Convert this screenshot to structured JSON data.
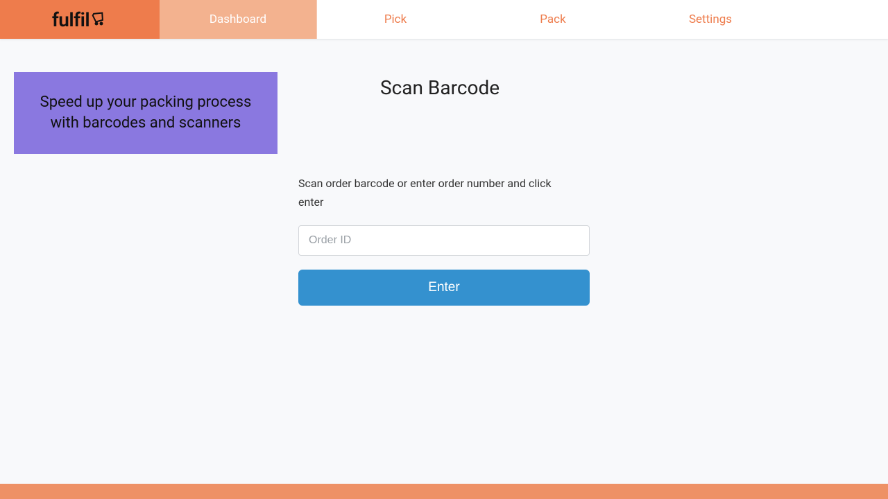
{
  "brand": {
    "name": "fulfil"
  },
  "nav": {
    "items": [
      {
        "label": "Dashboard",
        "active": true
      },
      {
        "label": "Pick",
        "active": false
      },
      {
        "label": "Pack",
        "active": false
      },
      {
        "label": "Settings",
        "active": false
      }
    ]
  },
  "promo": {
    "text": "Speed up your packing process with barcodes and scanners"
  },
  "main": {
    "heading": "Scan Barcode",
    "instruction": "Scan order barcode or enter order number and click enter",
    "order_input_placeholder": "Order ID",
    "enter_label": "Enter"
  },
  "footer": {
    "text": ""
  }
}
